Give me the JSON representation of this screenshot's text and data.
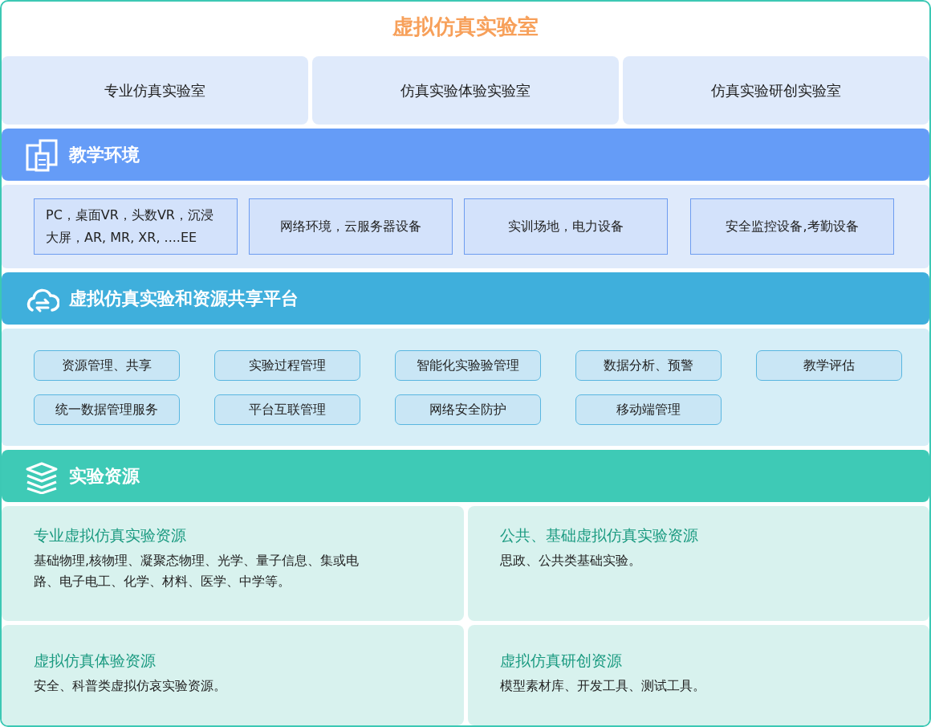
{
  "title": "虚拟仿真实验室",
  "labs": [
    "专业仿真实验室",
    "仿真实验体验实验室",
    "仿真实验研创实验室"
  ],
  "sections": [
    {
      "kind": "environment",
      "title": "教学环境",
      "items": [
        "PC，桌面VR，头数VR，沉浸大屏，AR, MR, XR, ....EE",
        "网络环境，云服务器设备",
        "实训场地，电力设备",
        "安全监控设备,考勤设备"
      ]
    },
    {
      "kind": "platform",
      "title": "虚拟仿真实验和资源共享平台",
      "items": [
        "资源管理、共享",
        "实验过程管理",
        "智能化实验验管理",
        "数据分析、预警",
        "教学评估",
        "统一数据管理服务",
        "平台互联管理",
        "网络安全防护",
        "移动端管理"
      ]
    },
    {
      "kind": "resources",
      "title": "实验资源",
      "cards": [
        {
          "heading": "专业虚拟仿真实验资源",
          "text": "基础物理,核物理、凝聚态物理、光学、量子信息、集或电路、电子电工、化学、材料、医学、中学等。"
        },
        {
          "heading": "公共、基础虚拟仿真实验资源",
          "text": "思政、公共类基础实验。"
        },
        {
          "heading": "虚拟仿真体验资源",
          "text": "安全、科普类虚拟仿哀实验资源。"
        },
        {
          "heading": "虚拟仿真研创资源",
          "text": "模型素材库、开发工具、测试工具。"
        }
      ]
    }
  ]
}
